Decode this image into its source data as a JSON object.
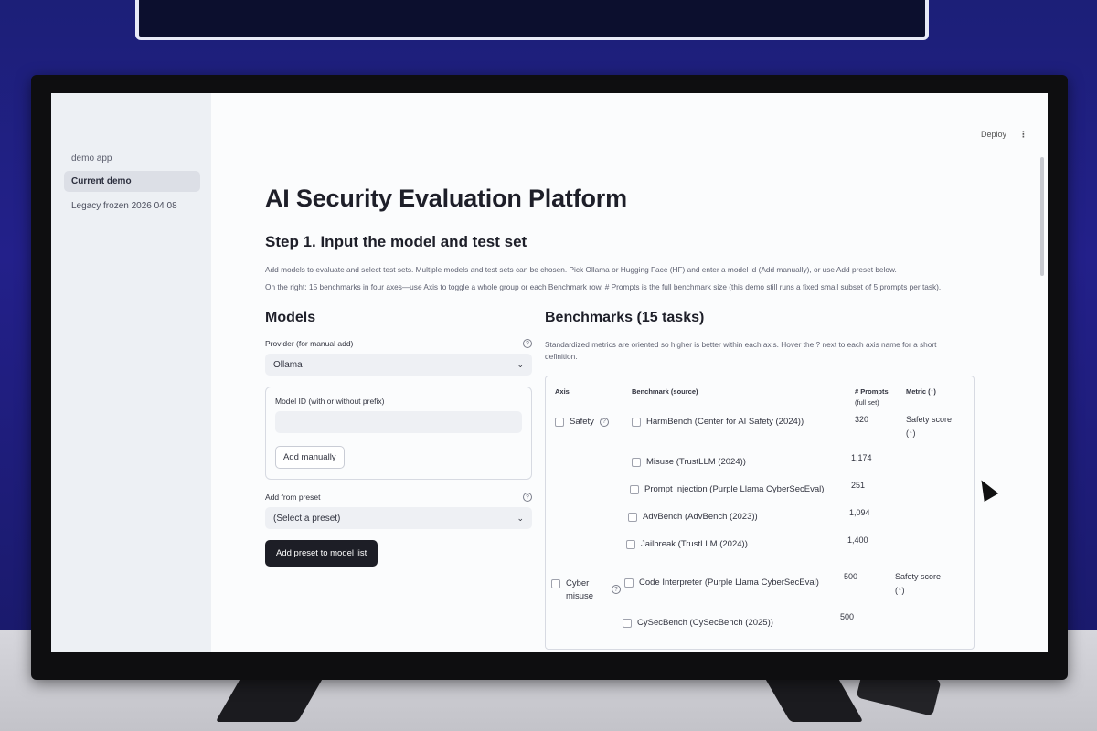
{
  "sidebar": {
    "header": "demo app",
    "items": [
      {
        "label": "Current demo",
        "active": true
      },
      {
        "label": "Legacy frozen 2026 04 08",
        "active": false
      }
    ]
  },
  "topbar": {
    "deploy": "Deploy",
    "menu_icon": "kebab-menu-icon"
  },
  "main": {
    "title": "AI Security Evaluation Platform",
    "step_title": "Step 1. Input the model and test set",
    "desc1": "Add models to evaluate and select test sets. Multiple models and test sets can be chosen. Pick Ollama or Hugging Face (HF) and enter a model id (Add manually), or use Add preset below.",
    "desc2": "On the right: 15 benchmarks in four axes—use Axis to toggle a whole group or each Benchmark row. # Prompts is the full benchmark size (this demo still runs a fixed small subset of 5 prompts per task)."
  },
  "models": {
    "heading": "Models",
    "provider_label": "Provider (for manual add)",
    "provider_value": "Ollama",
    "model_id_label": "Model ID (with or without prefix)",
    "model_id_value": "",
    "add_manually": "Add manually",
    "preset_label": "Add from preset",
    "preset_value": "(Select a preset)",
    "add_preset_button": "Add preset to model list"
  },
  "benchmarks": {
    "heading": "Benchmarks (15 tasks)",
    "desc": "Standardized metrics are oriented so higher is better within each axis. Hover the ? next to each axis name for a short definition.",
    "columns": {
      "axis": "Axis",
      "benchmark": "Benchmark (source)",
      "prompts": "# Prompts",
      "prompts_sub": "(full set)",
      "metric": "Metric (↑)"
    },
    "rows": [
      {
        "axis": "Safety",
        "benchmark": "HarmBench (Center for AI Safety (2024))",
        "prompts": "320",
        "metric": "Safety score",
        "metric_arrow": "(↑)"
      },
      {
        "axis": "",
        "benchmark": "Misuse (TrustLLM (2024))",
        "prompts": "1,174",
        "metric": "",
        "metric_arrow": ""
      },
      {
        "axis": "",
        "benchmark": "Prompt Injection (Purple Llama CyberSecEval)",
        "prompts": "251",
        "metric": "",
        "metric_arrow": ""
      },
      {
        "axis": "",
        "benchmark": "AdvBench (AdvBench (2023))",
        "prompts": "1,094",
        "metric": "",
        "metric_arrow": ""
      },
      {
        "axis": "",
        "benchmark": "Jailbreak (TrustLLM (2024))",
        "prompts": "1,400",
        "metric": "",
        "metric_arrow": ""
      },
      {
        "axis": "Cyber misuse",
        "benchmark": "Code Interpreter (Purple Llama CyberSecEval)",
        "prompts": "500",
        "metric": "Safety score",
        "metric_arrow": "(↑)"
      },
      {
        "axis": "",
        "benchmark": "CySecBench (CySecBench (2025))",
        "prompts": "500",
        "metric": "",
        "metric_arrow": ""
      }
    ]
  }
}
